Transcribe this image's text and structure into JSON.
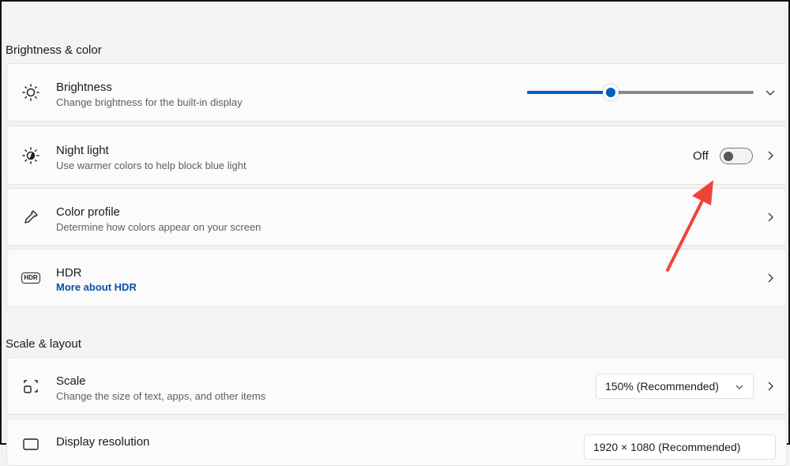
{
  "sections": {
    "brightness_color": "Brightness & color",
    "scale_layout": "Scale & layout"
  },
  "brightness": {
    "title": "Brightness",
    "subtitle": "Change brightness for the built-in display",
    "value_percent": 37
  },
  "night_light": {
    "title": "Night light",
    "subtitle": "Use warmer colors to help block blue light",
    "state": "Off"
  },
  "color_profile": {
    "title": "Color profile",
    "subtitle": "Determine how colors appear on your screen"
  },
  "hdr": {
    "title": "HDR",
    "link": "More about HDR",
    "icon_text": "HDR"
  },
  "scale": {
    "title": "Scale",
    "subtitle": "Change the size of text, apps, and other items",
    "selected": "150% (Recommended)"
  },
  "display_resolution": {
    "title": "Display resolution",
    "selected": "1920 × 1080 (Recommended)"
  },
  "colors": {
    "accent": "#0060bd",
    "arrow": "#f04438",
    "link": "#0a4fa8"
  }
}
